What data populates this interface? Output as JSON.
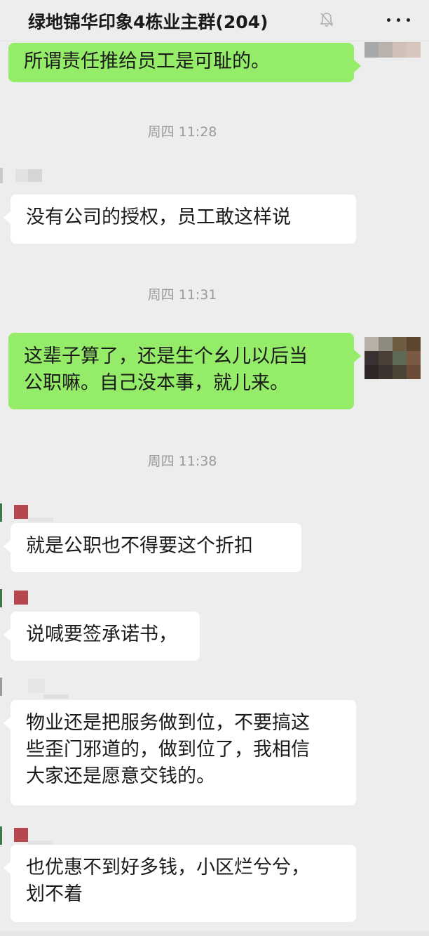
{
  "header": {
    "title": "绿地锦华印象4栋业主群(204)",
    "mute_icon": "bell-slash-icon",
    "more_icon": "more-dots-icon"
  },
  "messages": [
    {
      "kind": "outgoing",
      "text": "所谓责任推给员工是可耻的。"
    },
    {
      "kind": "timestamp",
      "text": "周四 11:28"
    },
    {
      "kind": "incoming",
      "text": "没有公司的授权，员工敢这样说"
    },
    {
      "kind": "timestamp",
      "text": "周四 11:31"
    },
    {
      "kind": "outgoing",
      "lines": [
        "这辈子算了，还是生个幺儿以后当",
        "公职嘛。自己没本事，就儿来。"
      ]
    },
    {
      "kind": "timestamp",
      "text": "周四 11:38"
    },
    {
      "kind": "incoming",
      "text": "就是公职也不得要这个折扣"
    },
    {
      "kind": "incoming",
      "text": "说喊要签承诺书，"
    },
    {
      "kind": "incoming",
      "lines": [
        "物业还是把服务做到位，不要搞这",
        "些歪门邪道的，做到位了，我相信",
        "大家还是愿意交钱的。"
      ]
    },
    {
      "kind": "incoming",
      "lines": [
        "也优惠不到好多钱，小区烂兮兮，",
        "划不着"
      ]
    }
  ],
  "colors": {
    "background": "#ededed",
    "outgoing_bubble": "#95ec69",
    "incoming_bubble": "#ffffff",
    "timestamp": "#9a9a9a",
    "avatar_marker": "#b5474e"
  }
}
